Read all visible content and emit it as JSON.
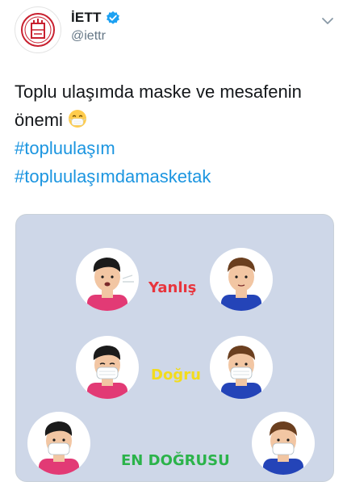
{
  "account": {
    "display_name": "İETT",
    "handle": "@iettr",
    "avatar_icon": "iett-logo",
    "verified_icon": "verified-badge-icon",
    "menu_icon": "chevron-down-icon"
  },
  "tweet": {
    "line1": "Toplu ulaşımda maske ve mesafenin",
    "line2": "önemi",
    "emoji_icon": "face-with-medical-mask-icon",
    "hashtags": [
      "#topluulaşım",
      "#topluulaşımdamasketak"
    ]
  },
  "image": {
    "labels": {
      "wrong": "Yanlış",
      "right": "Doğru",
      "best": "EN DOĞRUSU"
    },
    "colors": {
      "background": "#ced7e8",
      "wrong": "#e8353d",
      "right": "#f2dc1e",
      "best": "#2bb34a",
      "pink_shirt": "#e23a75",
      "blue_shirt": "#2444b8"
    }
  }
}
